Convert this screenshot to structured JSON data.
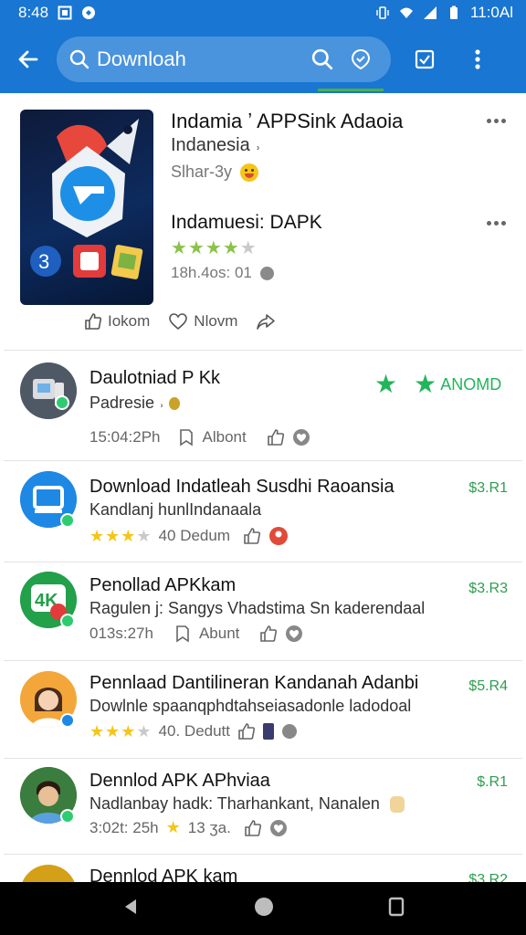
{
  "status": {
    "time": "8:48",
    "right_text": "11:0Al"
  },
  "search": {
    "query": "Downloah"
  },
  "featured": {
    "title": "Indamia ʼ APPSink Adaoia",
    "subtitle": "Indanesia ˒",
    "meta": "Slhar-3y",
    "title2": "Indamuesi: DAPK",
    "stars": 4.5,
    "meta2": "18h.4os: 01",
    "action_like": "Iokom",
    "action_heart": "Nlovm"
  },
  "items": [
    {
      "title": "Daulotniad P Kk",
      "sub": "Padresie ˒",
      "meta": "15:04:2Ph",
      "meta2": "Albont",
      "rating_label": "ANOMD",
      "avatar_color": "#6d6d6d",
      "badge_color": "#2ecc71"
    },
    {
      "title": "Download Indatleah Susdhi Raoansia",
      "sub": "Kandlanj hunlIndanaala",
      "stars": 3.5,
      "meta": "40 Dedum",
      "price": "$3.R1",
      "avatar_color": "#1e88e5",
      "badge_color": "#2ecc71"
    },
    {
      "title": "Penollad APKkam",
      "sub": "Ragulen j: Sangys Vhadstima Sn kaderendaal",
      "meta": "013s:27h",
      "meta2": "Abunt",
      "price": "$3.R3",
      "avatar_color": "#2e9e4f",
      "badge_color": "#2ecc71"
    },
    {
      "title": "Pennlaad Dantilineran Kandanah Adanbi",
      "sub": "Dowlnle spaanqphdtahseiasadonle ladodoal",
      "stars": 3.5,
      "meta": "40. Dedutt",
      "price": "$5.R4",
      "avatar_color": "#f5b041",
      "badge_color": "#1e88e5"
    },
    {
      "title": "Dennlod APK APhviaa",
      "sub": "Nadlanbay hadk: Tharhankant, Nanalen",
      "meta": "3:02t: 25h",
      "meta2": "13 ʒa.",
      "price": "$.R1",
      "avatar_color": "#2e7d32",
      "badge_color": "#2ecc71"
    },
    {
      "title": "Dennlod APK kam",
      "price": "$3.R2",
      "avatar_color": "#d4a017",
      "badge_color": "#2ecc71"
    }
  ],
  "colors": {
    "primary": "#1976d2",
    "accent_green": "#2e9e4f",
    "star": "#f5c518"
  }
}
